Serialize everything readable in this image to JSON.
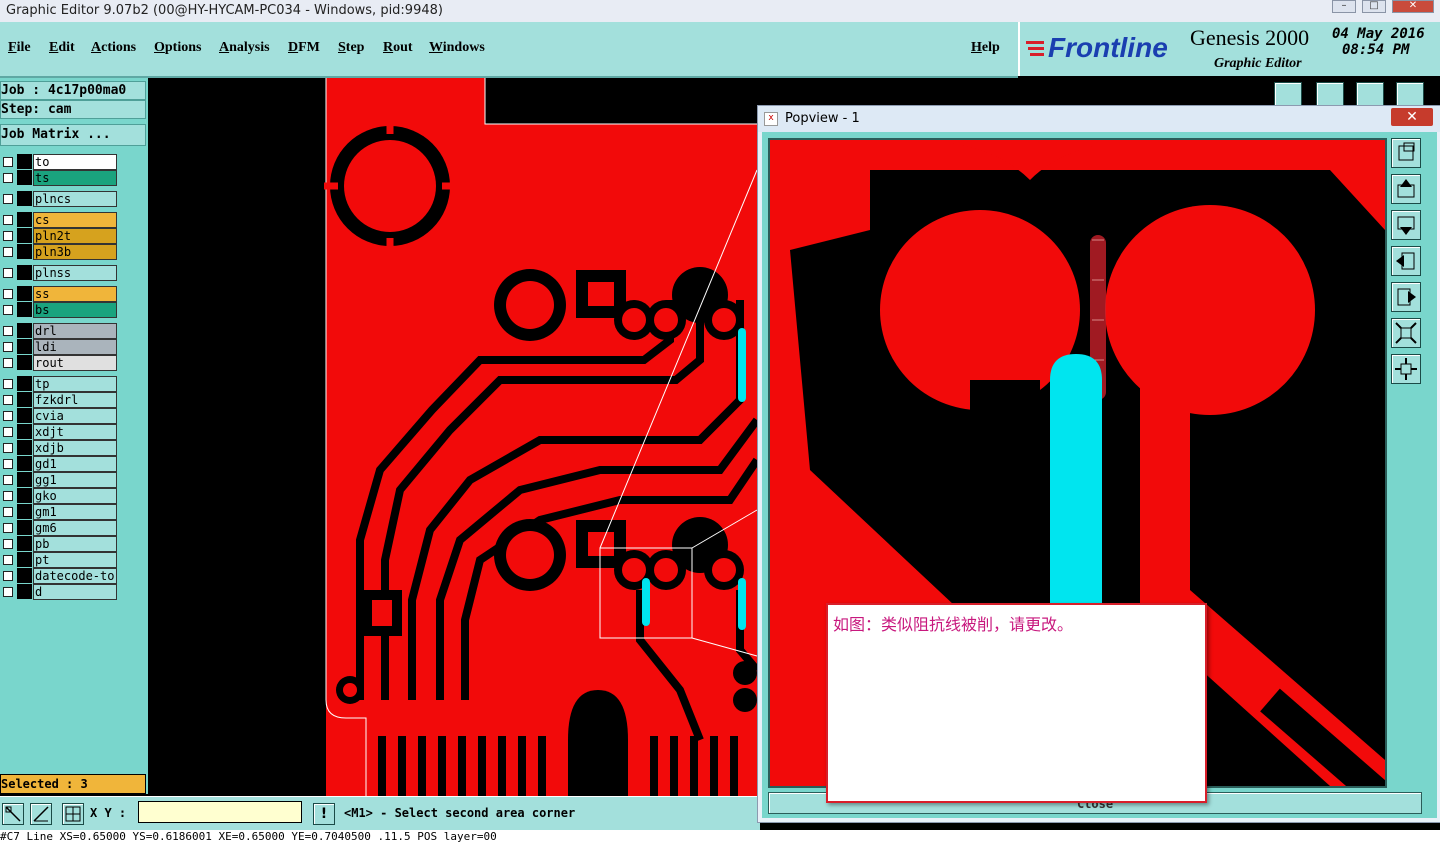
{
  "window": {
    "title": "Graphic Editor 9.07b2 (00@HY-HYCAM-PC034 - Windows, pid:9948)"
  },
  "menu": {
    "items": [
      "File",
      "Edit",
      "Actions",
      "Options",
      "Analysis",
      "DFM",
      "Step",
      "Rout",
      "Windows"
    ],
    "help": "Help"
  },
  "brand": {
    "logo": "Frontline",
    "product": "Genesis 2000",
    "subtitle": "Graphic Editor",
    "date": "04 May 2016",
    "time": "08:54 PM"
  },
  "job": {
    "job_line": "Job : 4c17p00ma0",
    "step_line": "Step: cam",
    "matrix_button": "Job Matrix ..."
  },
  "layers": [
    {
      "name": "to",
      "color": "#ffffff"
    },
    {
      "name": "ts",
      "color": "#1aa37e"
    },
    {
      "name": "plncs",
      "color": "#a3e0dc"
    },
    {
      "name": "cs",
      "color": "#f0b53a"
    },
    {
      "name": "pln2t",
      "color": "#d6a21e"
    },
    {
      "name": "pln3b",
      "color": "#d6a21e"
    },
    {
      "name": "plnss",
      "color": "#a3e0dc"
    },
    {
      "name": "ss",
      "color": "#f0b53a"
    },
    {
      "name": "bs",
      "color": "#1aa37e"
    },
    {
      "name": "drl",
      "color": "#aab4bc"
    },
    {
      "name": "ldi",
      "color": "#aab4bc"
    },
    {
      "name": "rout",
      "color": "#e0e0e0"
    },
    {
      "name": "tp",
      "color": "#a3e0dc"
    },
    {
      "name": "fzkdrl",
      "color": "#a3e0dc"
    },
    {
      "name": "cvia",
      "color": "#a3e0dc"
    },
    {
      "name": "xdjt",
      "color": "#a3e0dc"
    },
    {
      "name": "xdjb",
      "color": "#a3e0dc"
    },
    {
      "name": "gd1",
      "color": "#a3e0dc"
    },
    {
      "name": "gg1",
      "color": "#a3e0dc"
    },
    {
      "name": "gko",
      "color": "#a3e0dc"
    },
    {
      "name": "gm1",
      "color": "#a3e0dc"
    },
    {
      "name": "gm6",
      "color": "#a3e0dc"
    },
    {
      "name": "pb",
      "color": "#a3e0dc"
    },
    {
      "name": "pt",
      "color": "#a3e0dc"
    },
    {
      "name": "datecode-to",
      "color": "#a3e0dc"
    },
    {
      "name": "d",
      "color": "#a3e0dc"
    }
  ],
  "selection": {
    "text": "Selected : 3"
  },
  "coords": {
    "label": "X Y :",
    "value": ""
  },
  "prompt": {
    "message": "<M1> - Select second area corner"
  },
  "popview": {
    "title": "Popview - 1",
    "close_label": "Close"
  },
  "annotation": {
    "text": "如图：类似阻抗线被削，请更改。"
  },
  "statusline": {
    "text": "#C7 Line  XS=0.65000 YS=0.6186001 XE=0.65000 YE=0.7040500 .11.5 POS layer=00"
  },
  "colors": {
    "copper": "#f20a0a",
    "background": "#000000",
    "highlight": "#00e5ef",
    "panel": "#a3e0dc"
  }
}
